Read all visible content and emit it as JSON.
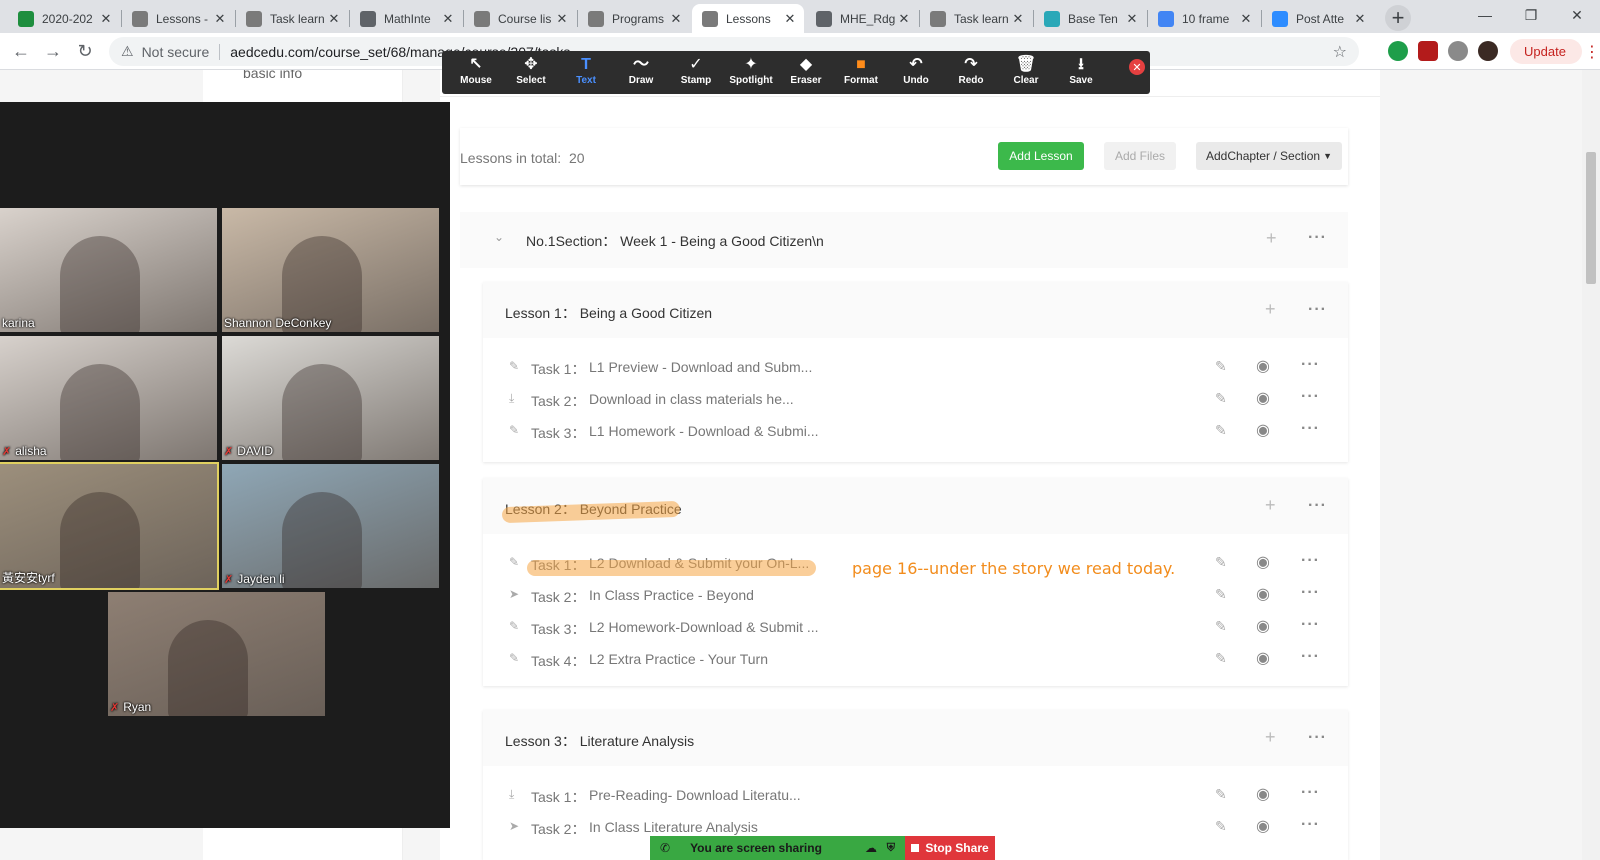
{
  "browser": {
    "tabs": [
      {
        "title": "2020-202",
        "color": "#1e8e3e",
        "glyph": "+"
      },
      {
        "title": "Lessons -",
        "color": "#7a7a7a",
        "glyph": ""
      },
      {
        "title": "Task learn",
        "color": "#7a7a7a",
        "glyph": ""
      },
      {
        "title": "MathInte",
        "color": "#5f6368",
        "glyph": ""
      },
      {
        "title": "Course lis",
        "color": "#7a7a7a",
        "glyph": ""
      },
      {
        "title": "Programs",
        "color": "#7a7a7a",
        "glyph": ""
      },
      {
        "title": "Lessons",
        "color": "#7a7a7a",
        "glyph": ""
      },
      {
        "title": "MHE_Rdg",
        "color": "#5f6368",
        "glyph": ""
      },
      {
        "title": "Task learn",
        "color": "#7a7a7a",
        "glyph": ""
      },
      {
        "title": "Base Ten",
        "color": "#2aa8b8",
        "glyph": ""
      },
      {
        "title": "10 frame",
        "color": "#4285f4",
        "glyph": ""
      },
      {
        "title": "Post Atte",
        "color": "#2d8cff",
        "glyph": ""
      }
    ],
    "active_tab_index": 6,
    "not_secure": "Not secure",
    "url": "aedcedu.com/course_set/68/manage/course/207/tasks",
    "update_label": "Update"
  },
  "left_nav": {
    "basic_info": "basic info"
  },
  "summary": {
    "lessons_total_label": "Lessons in total:",
    "lessons_total_value": "20",
    "add_lesson": "Add Lesson",
    "add_files": "Add Files",
    "add_chapter": "AddChapter / Section"
  },
  "section": {
    "title": "No.1Section： Week 1 - Being a Good Citizen\\n"
  },
  "lessons": [
    {
      "heading": "Lesson 1：  Being a Good Citizen",
      "tasks": [
        {
          "label": "Task 1：",
          "name": "L1 Preview - Download and Subm...",
          "icon": "✎"
        },
        {
          "label": "Task 2：",
          "name": "Download in class materials he...",
          "icon": "⤓"
        },
        {
          "label": "Task 3：",
          "name": "L1 Homework - Download & Submi...",
          "icon": "✎"
        }
      ]
    },
    {
      "heading": "Lesson 2：  Beyond Practice",
      "tasks": [
        {
          "label": "Task 1：",
          "name": "L2 Download & Submit your On-L...",
          "icon": "✎"
        },
        {
          "label": "Task 2：",
          "name": "In Class Practice - Beyond",
          "icon": "➤"
        },
        {
          "label": "Task 3：",
          "name": "L2 Homework-Download & Submit ...",
          "icon": "✎"
        },
        {
          "label": "Task 4：",
          "name": "L2 Extra Practice - Your Turn",
          "icon": "✎"
        }
      ]
    },
    {
      "heading": "Lesson 3：  Literature Analysis",
      "tasks": [
        {
          "label": "Task 1：",
          "name": "Pre-Reading- Download Literatu...",
          "icon": "⤓"
        },
        {
          "label": "Task 2：",
          "name": "In Class Literature Analysis",
          "icon": "➤"
        }
      ]
    }
  ],
  "annotation_note": "page 16--under the story we read today.",
  "annotate_tools": [
    "Mouse",
    "Select",
    "Text",
    "Draw",
    "Stamp",
    "Spotlight",
    "Eraser",
    "Format",
    "Undo",
    "Redo",
    "Clear",
    "Save"
  ],
  "annotate_active_tool": "Text",
  "participants": [
    {
      "name": "karina",
      "muted": false,
      "bg": "#d9d2cc"
    },
    {
      "name": "Shannon DeConkey",
      "muted": false,
      "bg": "#c9b9a7"
    },
    {
      "name": "alisha",
      "muted": true,
      "bg": "#d7d1cc"
    },
    {
      "name": "DAVID",
      "muted": true,
      "bg": "#dcdad6"
    },
    {
      "name": "黃安安tyrf",
      "muted": false,
      "bg": "#9c8f7c"
    },
    {
      "name": "Jayden li",
      "muted": true,
      "bg": "#8fa7b6"
    },
    {
      "name": "Ryan",
      "muted": true,
      "bg": "#8e7f73"
    }
  ],
  "share": {
    "status": "You are screen sharing",
    "stop": "Stop Share"
  },
  "colors": {
    "accent_green": "#3cb94b",
    "annotation_orange": "#f28c1c",
    "stop_red": "#e0363b"
  }
}
